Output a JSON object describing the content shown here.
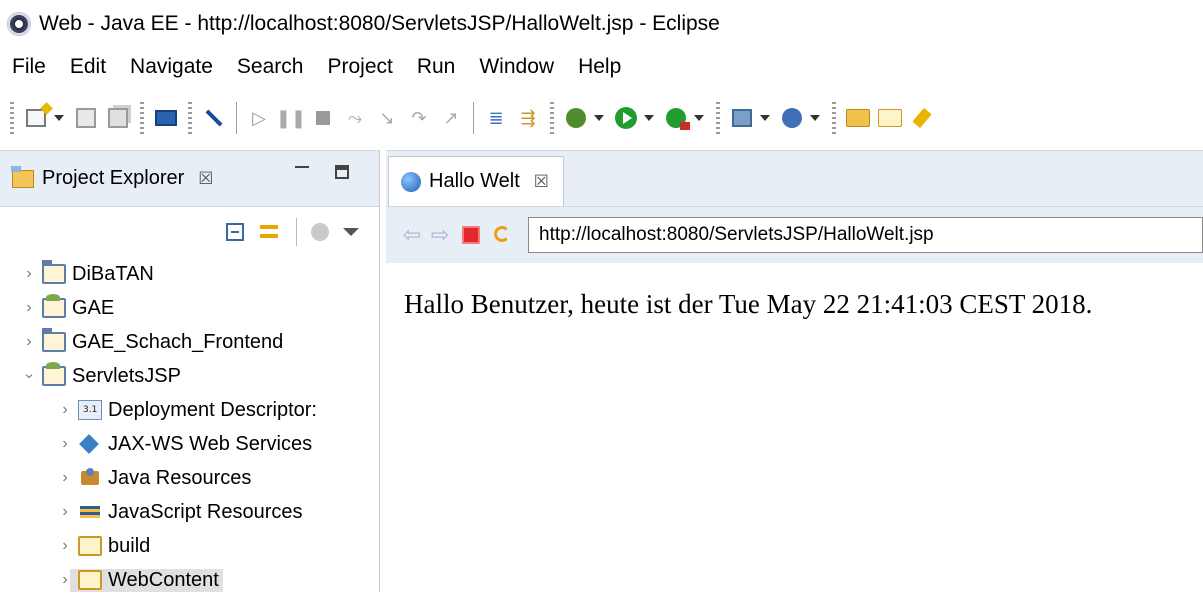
{
  "window": {
    "title": "Web - Java EE - http://localhost:8080/ServletsJSP/HalloWelt.jsp - Eclipse"
  },
  "menu": {
    "items": [
      "File",
      "Edit",
      "Navigate",
      "Search",
      "Project",
      "Run",
      "Window",
      "Help"
    ]
  },
  "project_explorer": {
    "tab_label": "Project Explorer",
    "tab_close": "☒",
    "tree": [
      {
        "label": "DiBaTAN",
        "expanded": false,
        "level": 0,
        "icon": "project-folder-icon"
      },
      {
        "label": "GAE",
        "expanded": false,
        "level": 0,
        "icon": "gae-project-icon"
      },
      {
        "label": "GAE_Schach_Frontend",
        "expanded": false,
        "level": 0,
        "icon": "project-folder-icon"
      },
      {
        "label": "ServletsJSP",
        "expanded": true,
        "level": 0,
        "icon": "web-project-icon"
      },
      {
        "label": "Deployment Descriptor:",
        "expanded": false,
        "level": 1,
        "icon": "deployment-descriptor-icon"
      },
      {
        "label": "JAX-WS Web Services",
        "expanded": false,
        "level": 1,
        "icon": "jaxws-icon"
      },
      {
        "label": "Java Resources",
        "expanded": false,
        "level": 1,
        "icon": "java-resources-icon"
      },
      {
        "label": "JavaScript Resources",
        "expanded": false,
        "level": 1,
        "icon": "javascript-resources-icon"
      },
      {
        "label": "build",
        "expanded": false,
        "level": 1,
        "icon": "folder-icon"
      },
      {
        "label": "WebContent",
        "expanded": false,
        "level": 1,
        "icon": "folder-icon",
        "selected": true
      }
    ]
  },
  "editor": {
    "tab_label": "Hallo Welt",
    "tab_close": "☒",
    "url": "http://localhost:8080/ServletsJSP/HalloWelt.jsp",
    "page_text": "Hallo Benutzer, heute ist der Tue May 22 21:41:03 CEST 2018."
  }
}
